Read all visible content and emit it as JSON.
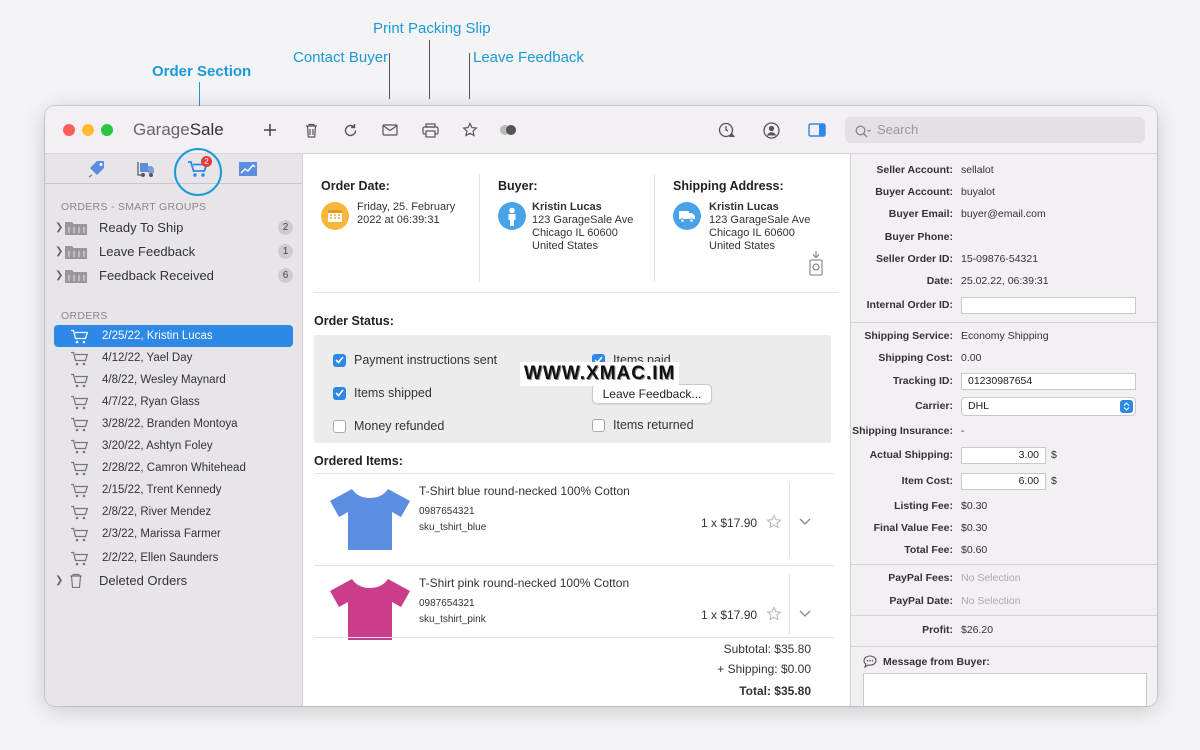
{
  "callouts": {
    "order_section": "Order Section",
    "contact_buyer": "Contact Buyer",
    "print_packing_slip": "Print Packing Slip",
    "leave_feedback": "Leave Feedback"
  },
  "app": {
    "title_pre": "Garage",
    "title_post": "Sale"
  },
  "search": {
    "placeholder": "Search"
  },
  "sidebar": {
    "cart_badge": "2",
    "smart_groups_heading": "ORDERS - SMART GROUPS",
    "smart_groups": [
      {
        "label": "Ready To Ship",
        "count": "2"
      },
      {
        "label": "Leave Feedback",
        "count": "1"
      },
      {
        "label": "Feedback Received",
        "count": "6"
      }
    ],
    "orders_heading": "ORDERS",
    "orders": [
      "2/25/22, Kristin Lucas",
      "4/12/22, Yael Day",
      "4/8/22, Wesley Maynard",
      "4/7/22, Ryan Glass",
      "3/28/22, Branden Montoya",
      "3/20/22, Ashtyn Foley",
      "2/28/22, Camron Whitehead",
      "2/15/22, Trent Kennedy",
      "2/8/22, River Mendez",
      "2/3/22, Marissa Farmer",
      "2/2/22, Ellen Saunders"
    ],
    "deleted_orders": "Deleted Orders"
  },
  "order": {
    "date_label": "Order Date:",
    "date_line1": "Friday, 25. February",
    "date_line2": "2022 at 06:39:31",
    "buyer_label": "Buyer:",
    "buyer_name": "Kristin Lucas",
    "buyer_addr1": "123 GarageSale Ave",
    "buyer_addr2": "Chicago IL 60600",
    "buyer_addr3": "United States",
    "ship_label": "Shipping Address:",
    "ship_name": "Kristin Lucas",
    "ship_addr1": "123 GarageSale Ave",
    "ship_addr2": "Chicago IL 60600",
    "ship_addr3": "United States",
    "status_label": "Order Status:",
    "payment_sent": "Payment instructions sent",
    "items_paid": "Items paid",
    "items_shipped": "Items shipped",
    "leave_feedback_button": "Leave Feedback...",
    "money_refunded": "Money refunded",
    "items_returned": "Items returned",
    "items_label": "Ordered Items:",
    "items": [
      {
        "title": "T-Shirt blue round-necked 100% Cotton",
        "id": "0987654321",
        "sku": "sku_tshirt_blue",
        "qty_price": "1 x $17.90",
        "color": "#5b8ee0"
      },
      {
        "title": "T-Shirt pink round-necked 100% Cotton",
        "id": "0987654321",
        "sku": "sku_tshirt_pink",
        "qty_price": "1 x $17.90",
        "color": "#c93d8a"
      }
    ],
    "subtotal": "Subtotal: $35.80",
    "shipping": "+ Shipping: $0.00",
    "total": "Total: $35.80"
  },
  "details": {
    "seller_account_k": "Seller Account:",
    "seller_account_v": "sellalot",
    "buyer_account_k": "Buyer Account:",
    "buyer_account_v": "buyalot",
    "buyer_email_k": "Buyer Email:",
    "buyer_email_v": "buyer@email.com",
    "buyer_phone_k": "Buyer Phone:",
    "seller_order_id_k": "Seller Order ID:",
    "seller_order_id_v": "15-09876-54321",
    "date_k": "Date:",
    "date_v": "25.02.22, 06:39:31",
    "internal_order_id_k": "Internal Order ID:",
    "shipping_service_k": "Shipping Service:",
    "shipping_service_v": "Economy Shipping",
    "shipping_cost_k": "Shipping Cost:",
    "shipping_cost_v": "0.00",
    "tracking_id_k": "Tracking ID:",
    "tracking_id_v": "01230987654",
    "carrier_k": "Carrier:",
    "carrier_v": "DHL",
    "shipping_insurance_k": "Shipping Insurance:",
    "shipping_insurance_v": "-",
    "actual_shipping_k": "Actual Shipping:",
    "actual_shipping_v": "3.00",
    "item_cost_k": "Item Cost:",
    "item_cost_v": "6.00",
    "currency": "$",
    "listing_fee_k": "Listing Fee:",
    "listing_fee_v": "$0.30",
    "final_value_fee_k": "Final Value Fee:",
    "final_value_fee_v": "$0.30",
    "total_fee_k": "Total Fee:",
    "total_fee_v": "$0.60",
    "paypal_fees_k": "PayPal Fees:",
    "paypal_fees_v": "No Selection",
    "paypal_date_k": "PayPal Date:",
    "paypal_date_v": "No Selection",
    "profit_k": "Profit:",
    "profit_v": "$26.20",
    "message_k": "Message from Buyer:"
  },
  "watermark": "WWW.XMAC.IM"
}
